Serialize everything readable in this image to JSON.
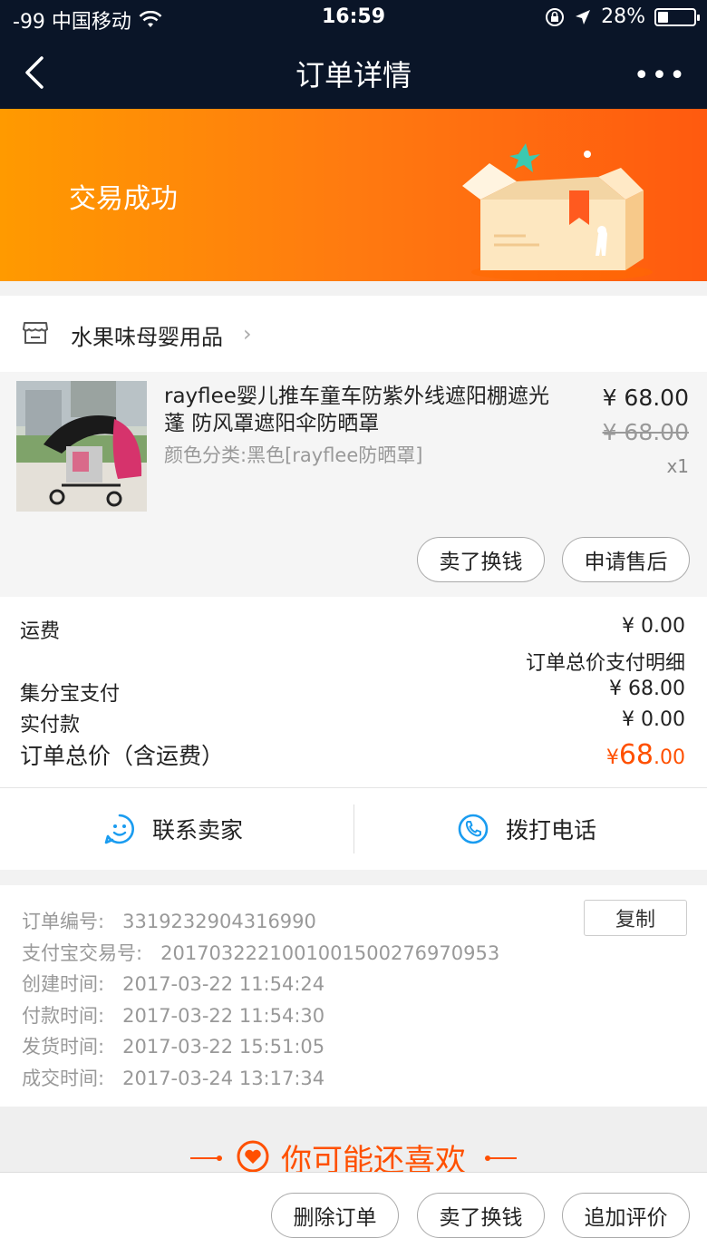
{
  "status_bar": {
    "carrier": "-99 中国移动",
    "time": "16:59",
    "battery": "28%",
    "battery_level": 0.28
  },
  "nav": {
    "title": "订单详情"
  },
  "banner": {
    "status": "交易成功"
  },
  "shop": {
    "name": "水果味母婴用品"
  },
  "product": {
    "title": "rayflee婴儿推车童车防紫外线遮阳棚遮光蓬 防风罩遮阳伞防晒罩",
    "variant": "颜色分类:黑色[rayflee防晒罩]",
    "price": "¥ 68.00",
    "original_price": "¥ 68.00",
    "quantity": "x1",
    "buttons": [
      "卖了换钱",
      "申请售后"
    ]
  },
  "summary": {
    "shipping_label": "运费",
    "shipping_value": "¥ 0.00",
    "detail_link": "订单总价支付明细",
    "points_label": "集分宝支付",
    "points_value": "¥ 68.00",
    "paid_label": "实付款",
    "paid_value": "¥ 0.00",
    "total_label": "订单总价（含运费）",
    "total_currency": "¥",
    "total_integer": "68",
    "total_decimal": ".00"
  },
  "contact": {
    "seller_label": "联系卖家",
    "call_label": "拨打电话"
  },
  "order_info": {
    "copy_label": "复制",
    "rows": [
      {
        "label": "订单编号:",
        "value": "3319232904316990"
      },
      {
        "label": "支付宝交易号:",
        "value": "2017032221001001500276970953"
      },
      {
        "label": "创建时间:",
        "value": "2017-03-22 11:54:24"
      },
      {
        "label": "付款时间:",
        "value": "2017-03-22 11:54:30"
      },
      {
        "label": "发货时间:",
        "value": "2017-03-22 15:51:05"
      },
      {
        "label": "成交时间:",
        "value": "2017-03-24 13:17:34"
      }
    ]
  },
  "recommend": {
    "title": "你可能还喜欢"
  },
  "bottom_bar": {
    "buttons": [
      "删除订单",
      "卖了换钱",
      "追加评价"
    ]
  },
  "colors": {
    "accent": "#ff5000",
    "nav_bg": "#0a1528",
    "banner_start": "#ff9a00",
    "banner_end": "#ff5a0f",
    "contact_icon": "#1a9cf0"
  }
}
